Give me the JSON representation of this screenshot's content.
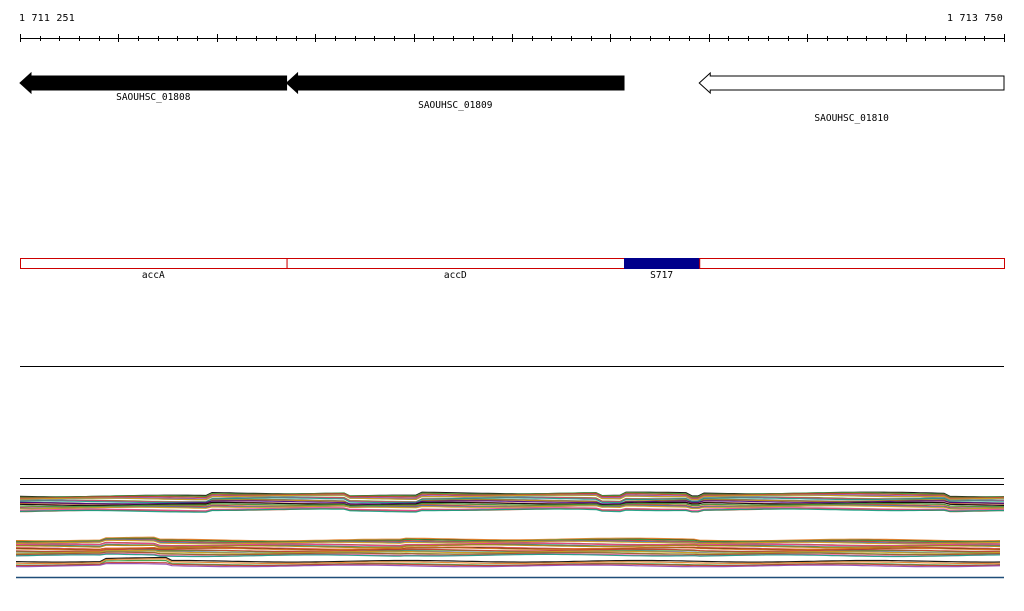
{
  "range": {
    "start_label": "1 711 251",
    "end_label": "1 713 750",
    "start": 1711251,
    "end": 1713750
  },
  "genes": [
    {
      "id": "SAOUHSC_01808",
      "start": 1711251,
      "end": 1711928,
      "strand": "-",
      "fill": "#000000"
    },
    {
      "id": "SAOUHSC_01809",
      "start": 1711928,
      "end": 1712785,
      "strand": "-",
      "fill": "#000000"
    },
    {
      "id": "SAOUHSC_01810",
      "start": 1712976,
      "end": 1713750,
      "strand": "-",
      "fill": "#ffffff"
    }
  ],
  "features": [
    {
      "name": "accA",
      "start": 1711251,
      "end": 1711928,
      "fill": "#ffffff",
      "stroke": "#cc0000"
    },
    {
      "name": "accD",
      "start": 1711928,
      "end": 1712785,
      "fill": "#ffffff",
      "stroke": "#cc0000"
    },
    {
      "name": "S717",
      "start": 1712785,
      "end": 1712976,
      "fill": "#00008b",
      "stroke": "#00008b"
    },
    {
      "name": "",
      "start": 1712976,
      "end": 1713750,
      "fill": "#ffffff",
      "stroke": "#cc0000"
    }
  ],
  "colors": {
    "outline": "#cc0000",
    "srna": "#00008b",
    "gene_fill": "#000000"
  }
}
